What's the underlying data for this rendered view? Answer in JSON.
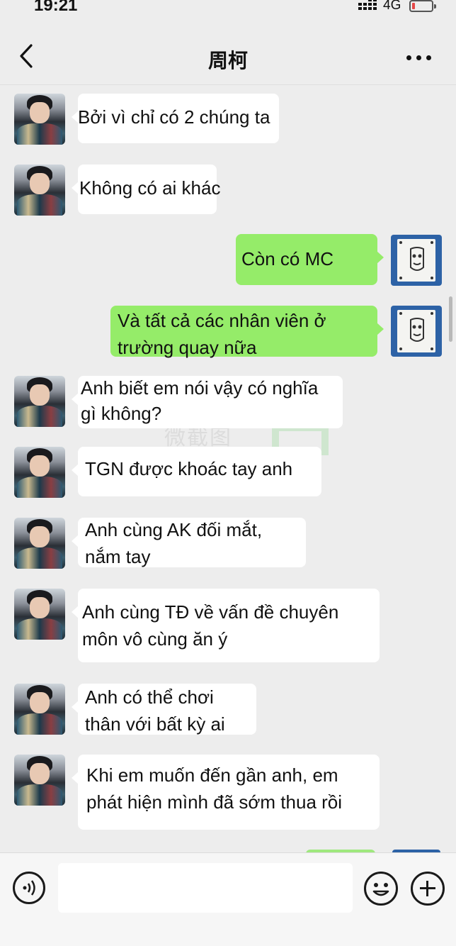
{
  "status_bar": {
    "time": "19:21",
    "network": "4G"
  },
  "header": {
    "back_icon": "chevron-left-icon",
    "title": "周柯",
    "more_icon": "more-dots-icon"
  },
  "messages": [
    {
      "side": "left",
      "lines": [
        "Bởi vì chỉ có 2 chúng ta"
      ]
    },
    {
      "side": "left",
      "lines": [
        "Không có ai khác"
      ]
    },
    {
      "side": "right",
      "lines": [
        "Còn có MC"
      ]
    },
    {
      "side": "right",
      "lines": [
        "Và tất cả các nhân viên ở",
        "trường quay nữa"
      ]
    },
    {
      "side": "left",
      "lines": [
        "Anh biết em nói vậy có nghĩa",
        "gì không?"
      ]
    },
    {
      "side": "left",
      "lines": [
        "TGN được khoác tay anh"
      ]
    },
    {
      "side": "left",
      "lines": [
        "Anh cùng AK đối mắt,",
        "nắm tay"
      ]
    },
    {
      "side": "left",
      "lines": [
        "Anh cùng TĐ về vấn đề chuyên",
        "môn vô cùng ăn ý"
      ]
    },
    {
      "side": "left",
      "lines": [
        "Anh có thể chơi",
        "thân với bất kỳ ai"
      ]
    },
    {
      "side": "left",
      "lines": [
        "Khi em muốn đến gần anh, em",
        "phát hiện mình đã sớm thua rồi"
      ]
    }
  ],
  "watermark": "微截图",
  "input_bar": {
    "voice_icon": "voice-icon",
    "input_value": "",
    "emoji_icon": "emoji-icon",
    "plus_icon": "plus-icon"
  },
  "colors": {
    "background": "#ededed",
    "bubble_left": "#ffffff",
    "bubble_right": "#95ec69",
    "right_avatar": "#2d62a6"
  }
}
